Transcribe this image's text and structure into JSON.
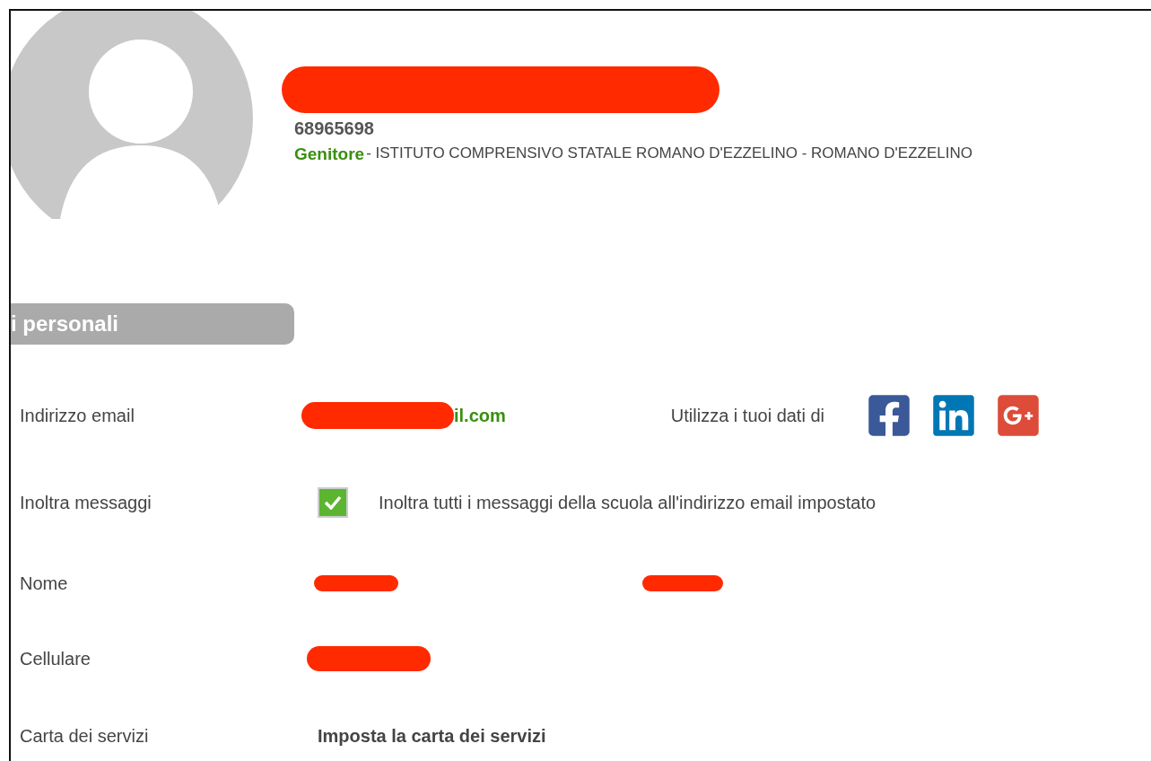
{
  "profile": {
    "id_number": "68965698",
    "role": "Genitore",
    "institution": " - ISTITUTO COMPRENSIVO STATALE ROMANO D'EZZELINO - ROMANO D'EZZELINO"
  },
  "section": {
    "title": "i personali"
  },
  "rows": [
    {
      "kind": "email",
      "label": "Indirizzo email",
      "value": "il.com",
      "social_label": "Utilizza i tuoi dati di"
    },
    {
      "kind": "checkbox",
      "label": "Inoltra messaggi",
      "checked": true,
      "text": "Inoltra tutti i messaggi della scuola all'indirizzo email impostato"
    },
    {
      "kind": "name",
      "label": "Nome"
    },
    {
      "kind": "phone",
      "label": "Cellulare"
    },
    {
      "kind": "link",
      "label": "Carta dei servizi",
      "value": "Imposta la carta dei servizi"
    }
  ]
}
